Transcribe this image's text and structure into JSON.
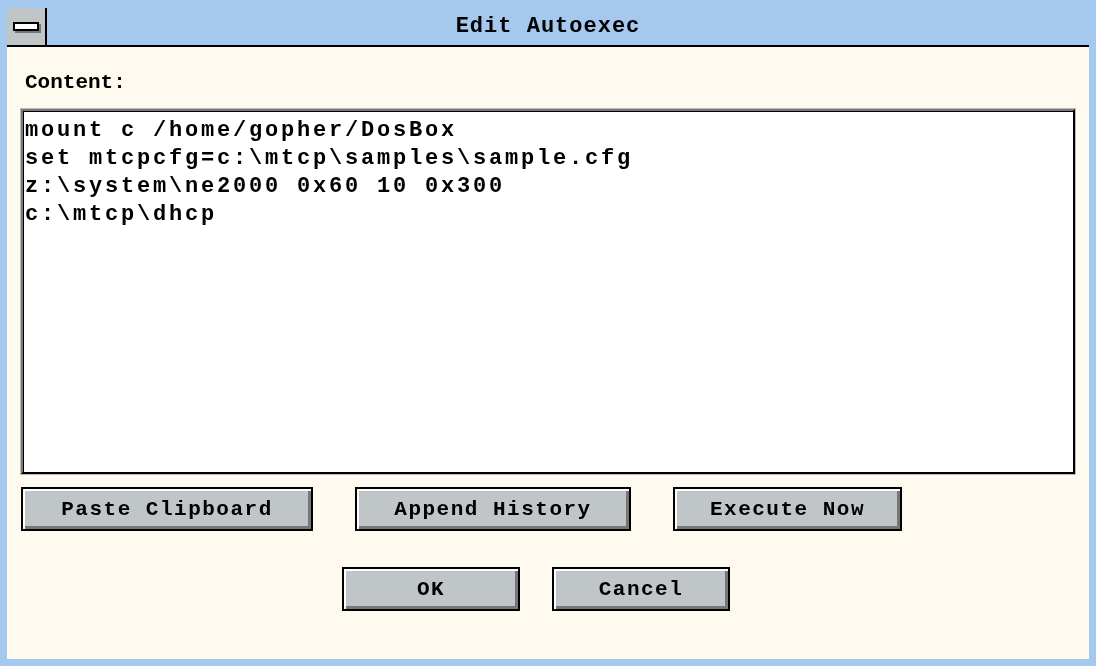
{
  "window": {
    "title": "Edit Autoexec"
  },
  "content": {
    "label": "Content:",
    "lines": [
      "mount c /home/gopher/DosBox",
      "set mtcpcfg=c:\\mtcp\\samples\\sample.cfg",
      "z:\\system\\ne2000 0x60 10 0x300",
      "c:\\mtcp\\dhcp"
    ]
  },
  "actions": [
    "Paste Clipboard",
    "Append History",
    "Execute Now"
  ],
  "buttons": [
    "OK",
    "Cancel"
  ]
}
